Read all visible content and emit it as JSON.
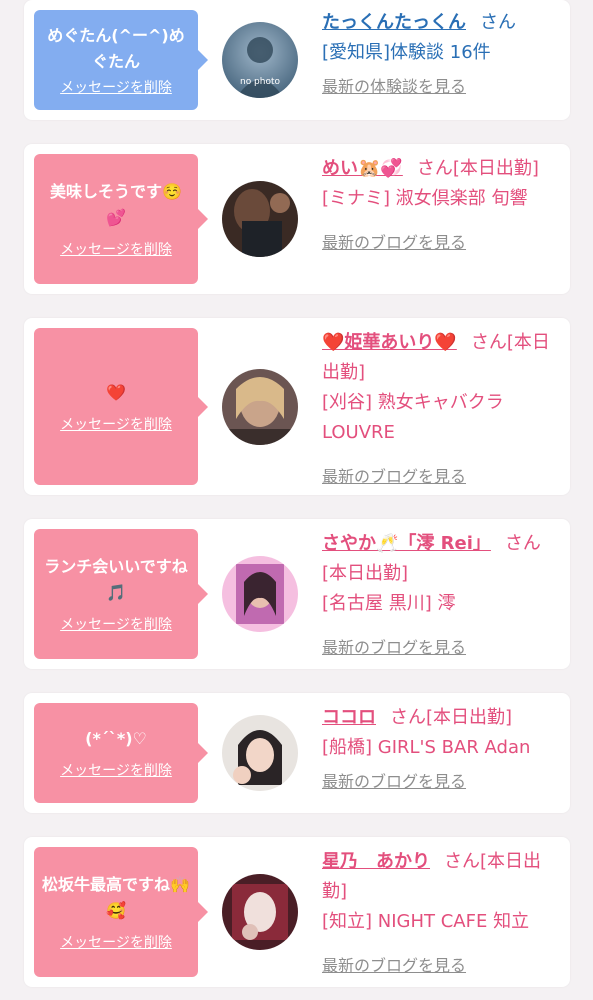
{
  "colors": {
    "blue_bubble": "#83adf0",
    "pink_bubble": "#f791a4",
    "blue_text": "#2a6fb5",
    "pink_text": "#e34f7d"
  },
  "cards": [
    {
      "message": "めぐたん(^ー^)めぐたん",
      "delete_label": "メッセージを削除",
      "name": "たっくんたっくん",
      "honorific": "さん",
      "shop": "[愛知県]体験談 16件",
      "link": "最新の体験談を見る",
      "avatar": "no-photo-avatar",
      "avatar_text": "no photo"
    },
    {
      "message": "美味しそうです☺️💕",
      "delete_label": "メッセージを削除",
      "name": "めい🐹💞",
      "honorific": "さん[本日出勤]",
      "shop": "[ミナミ] 淑女倶楽部 旬響",
      "link": "最新のブログを見る",
      "avatar": "photo-avatar"
    },
    {
      "message": "❤️",
      "delete_label": "メッセージを削除",
      "name": "❤️姫華あいり❤️",
      "honorific": "さん[本日出勤]",
      "shop": "[刈谷] 熟女キャバクラ LOUVRE",
      "link": "最新のブログを見る",
      "avatar": "photo-avatar"
    },
    {
      "message": "ランチ会いいですね🎵",
      "delete_label": "メッセージを削除",
      "name": "さやか🥂「澪 Rei」",
      "honorific": "さん[本日出勤]",
      "shop": "[名古屋 黒川] 澪",
      "link": "最新のブログを見る",
      "avatar": "photo-avatar"
    },
    {
      "message": "(*´`*)♡",
      "delete_label": "メッセージを削除",
      "name": "ココロ",
      "honorific": "さん[本日出勤]",
      "shop": "[船橋] GIRL'S BAR Adan",
      "link": "最新のブログを見る",
      "avatar": "photo-avatar"
    },
    {
      "message": "松坂牛最高ですね🙌🥰",
      "delete_label": "メッセージを削除",
      "name": "星乃　あかり",
      "honorific": "さん[本日出勤]",
      "shop": "[知立] NIGHT CAFE 知立",
      "link": "最新のブログを見る",
      "avatar": "photo-avatar"
    }
  ]
}
